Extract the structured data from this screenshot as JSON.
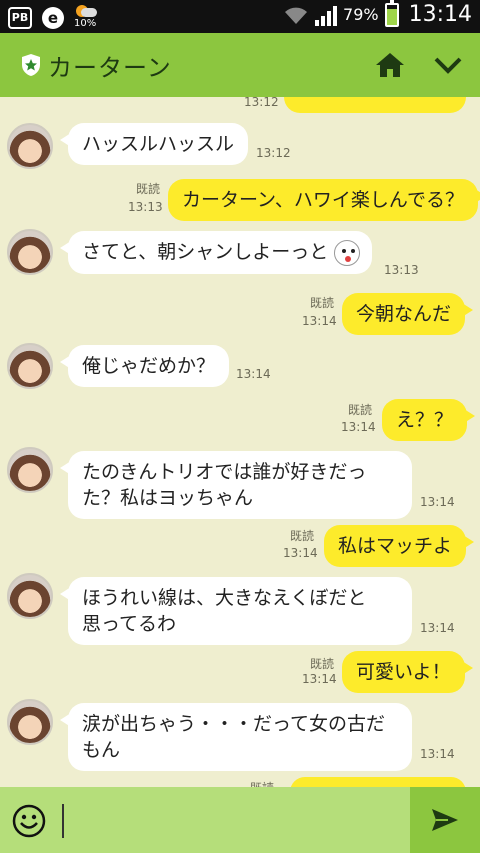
{
  "status_bar": {
    "weather_pct": "10%",
    "battery_pct": "79%",
    "time": "13:14",
    "battery_level": 0.79
  },
  "header": {
    "title": "カーターン",
    "icons": [
      "shield-star-icon",
      "home-icon",
      "chevron-down-icon"
    ],
    "accent": "#8cc63f"
  },
  "messages": [
    {
      "side": "out",
      "text": "…",
      "time": "13:12",
      "read": "",
      "partial": true
    },
    {
      "side": "in",
      "text": "ハッスルハッスル",
      "time": "13:12"
    },
    {
      "side": "out",
      "text": "カーターン、ハワイ楽しんでる？",
      "time": "13:13",
      "read": "既読"
    },
    {
      "side": "in",
      "text": "さてと、朝シャンしよーっと",
      "time": "13:13",
      "sticker": "bunny-face-icon"
    },
    {
      "side": "out",
      "text": "今朝なんだ",
      "time": "13:14",
      "read": "既読"
    },
    {
      "side": "in",
      "text": "俺じゃだめか？",
      "time": "13:14"
    },
    {
      "side": "out",
      "text": "え？？",
      "time": "13:14",
      "read": "既読"
    },
    {
      "side": "in",
      "text": "たのきんトリオでは誰が好きだった？私はヨッちゃん",
      "line1": "たのきんトリオでは誰が好きだっ",
      "line2": "た？私はヨッちゃん",
      "time": "13:14"
    },
    {
      "side": "out",
      "text": "私はマッチよ",
      "time": "13:14",
      "read": "既読"
    },
    {
      "side": "in",
      "text": "ほうれい線は、大きなえくぼだと思ってるわ",
      "line1": "ほうれい線は、大きなえくぼだと",
      "line2": "思ってるわ",
      "time": "13:14"
    },
    {
      "side": "out",
      "text": "可愛いよ！",
      "time": "13:14",
      "read": "既読"
    },
    {
      "side": "in",
      "text": "涙が出ちゃう・・・だって女の古だもん",
      "line1": "涙が出ちゃう・・・だって女の古だ",
      "line2": "もん",
      "time": "13:14"
    },
    {
      "side": "out",
      "text": "",
      "time": "",
      "read": "既読",
      "partial": true
    }
  ],
  "input_bar": {
    "emoji_icon": "smiley-icon",
    "send_icon": "send-arrow-icon",
    "value": ""
  }
}
